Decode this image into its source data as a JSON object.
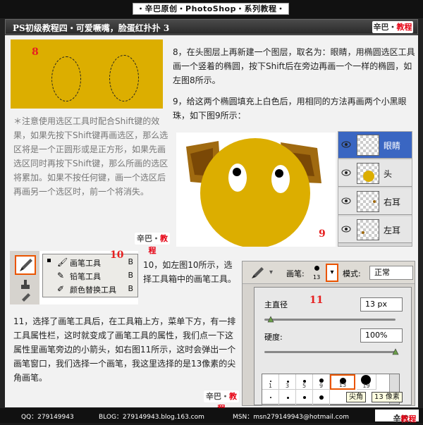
{
  "header": {
    "banner": "・辛巴原创・PhotoShop・系列教程・",
    "title": "PS初级教程四・可爱噘嘴，脸蛋红扑扑 3",
    "logo_a": "辛巴",
    "logo_b": "教程"
  },
  "step8": {
    "num": "8",
    "text": "8，在头图层上再新建一个图层，取名为：眼睛，用椭圆选区工具画一个竖着的椭圆，按下Shift后在旁边再画一个一样的椭圆，如左图8所示。"
  },
  "step9": {
    "num": "9",
    "text": "9，给这两个椭圆填充上白色后，用相同的方法再画两个小黑眼珠，如下图9所示："
  },
  "tip": {
    "text": "＊注意使用选区工具时配合Shift键的效果，如果先按下Shift键再画选区，那么选区将是一个正圆形或是正方形，如果先画选区同时再按下Shift键，那么所画的选区将累加。如果不按任何键，画一个选区后再画另一个选区时，前一个将消失。"
  },
  "layers": [
    {
      "name": "眼睛",
      "selected": true
    },
    {
      "name": "头",
      "selected": false
    },
    {
      "name": "右耳",
      "selected": false
    },
    {
      "name": "左耳",
      "selected": false
    }
  ],
  "step10": {
    "num": "10",
    "text": "10，如左图10所示，选择工具箱中的画笔工具。",
    "tools": [
      {
        "label": "画笔工具",
        "key": "B",
        "icon": "brush-icon"
      },
      {
        "label": "铅笔工具",
        "key": "B",
        "icon": "pencil-icon"
      },
      {
        "label": "颜色替换工具",
        "key": "B",
        "icon": "color-replace-icon"
      }
    ]
  },
  "step11": {
    "num": "11",
    "text": "11，选择了画笔工具后，在工具箱上方，菜单下方，有一排工具属性栏，这时就变成了画笔工具的属性，我们点一下这属性里画笔旁边的小箭头，如右图11所示，这时会弹出一个画笔窗口，我们选择一个画笔，我这里选择的是13像素的尖角画笔。",
    "brush_label": "画笔:",
    "brush_size_small": "13",
    "mode_label": "模式:",
    "mode_value": "正常",
    "diameter_label": "主直径",
    "diameter_value": "13 px",
    "hardness_label": "硬度:",
    "hardness_value": "100%",
    "diameter_fraction": 0.05,
    "hardness_fraction": 1.0,
    "brushes_row1": [
      "1",
      "3",
      "5",
      "9",
      "13",
      "19"
    ],
    "tooltip_a": "尖角",
    "tooltip_b": "13 像素"
  },
  "footer": {
    "qq": "QQ：279149943",
    "blog": "BLOG：279149943.blog.163.com",
    "msn": "MSN：msn279149943@hotmail.com",
    "logo_a": "辛巴",
    "logo_b": "教程"
  },
  "colors": {
    "head_yellow": "#dcae00",
    "ear_brown": "#a06a10",
    "highlight_orange": "#ea5400",
    "number_red": "#e62020",
    "layer_selected": "#3a66c2"
  }
}
